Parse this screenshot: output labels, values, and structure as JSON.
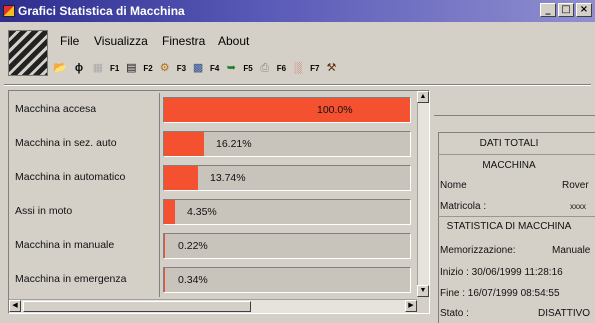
{
  "window": {
    "title": "Grafici Statistica di Macchina",
    "controls": [
      "_",
      "□",
      "×"
    ]
  },
  "menu": {
    "items": [
      {
        "label": "File"
      },
      {
        "label": "Visualizza"
      },
      {
        "label": "Finestra"
      },
      {
        "label": "About"
      }
    ]
  },
  "toolbar": {
    "buttons": [
      {
        "icon": "open-folder-icon",
        "key": ""
      },
      {
        "icon": "lightning-icon",
        "key": ""
      },
      {
        "icon": "disabled-tool-icon",
        "key": "F1"
      },
      {
        "icon": "chart-icon",
        "key": "F2"
      },
      {
        "icon": "gear-chart-icon",
        "key": "F3"
      },
      {
        "icon": "document-icon",
        "key": "F4"
      },
      {
        "icon": "arrows-icon",
        "key": "F5"
      },
      {
        "icon": "printer-icon",
        "key": "F6"
      },
      {
        "icon": "bar-chart-icon",
        "key": "F7"
      },
      {
        "icon": "tools-icon",
        "key": ""
      }
    ]
  },
  "chart_data": {
    "type": "bar",
    "categories": [
      "Macchina accesa",
      "Macchina in sez. auto",
      "Macchina in automatico",
      "Assi in moto",
      "Macchina in manuale",
      "Macchina in emergenza"
    ],
    "values": [
      100.0,
      16.21,
      13.74,
      4.35,
      0.22,
      0.34
    ],
    "value_labels": [
      "100.0%",
      "16.21%",
      "13.74%",
      "4.35%",
      "0.22%",
      "0.34%"
    ],
    "xlim": [
      0,
      100
    ],
    "bar_color": "#f35130",
    "orientation": "horizontal"
  },
  "summary": {
    "header": "DATI TOTALI",
    "machine_section": "MACCHINA",
    "nome_label": "Nome",
    "nome_value": "Rover",
    "matricola_label": "Matricola :",
    "matricola_value": "xxxx",
    "stats_section": "STATISTICA DI MACCHINA",
    "memorizzazione_label": "Memorizzazione:",
    "memorizzazione_value": "Manuale",
    "inizio": "Inizio : 30/06/1999 11:28:16",
    "fine": "Fine : 16/07/1999 08:54:55",
    "stato_label": "Stato :",
    "stato_value": "DISATTIVO"
  }
}
